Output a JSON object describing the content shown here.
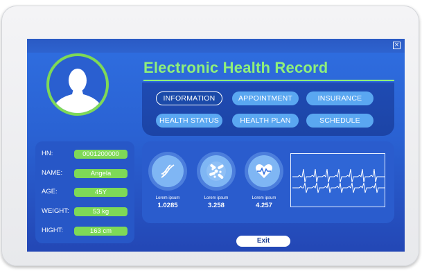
{
  "header": {
    "title": "Electronic Health Record",
    "close_icon": "close-icon"
  },
  "menu": {
    "buttons": [
      {
        "label": "INFORMATION",
        "active": true
      },
      {
        "label": "APPOINTMENT",
        "active": false
      },
      {
        "label": "INSURANCE",
        "active": false
      },
      {
        "label": "HEALTH STATUS",
        "active": false
      },
      {
        "label": "HEALTH PLAN",
        "active": false
      },
      {
        "label": "SCHEDULE",
        "active": false
      }
    ]
  },
  "patient": {
    "fields": [
      {
        "label": "HN:",
        "value": "0001200000"
      },
      {
        "label": "NAME:",
        "value": "Angela"
      },
      {
        "label": "AGE:",
        "value": "45Y"
      },
      {
        "label": "WEIGHT:",
        "value": "53 kg"
      },
      {
        "label": "HIGHT:",
        "value": "163 cm"
      }
    ]
  },
  "stats": [
    {
      "icon": "dna-icon",
      "label": "Lorem ipsum",
      "value": "1.0285"
    },
    {
      "icon": "pills-icon",
      "label": "Lorem ipsum",
      "value": "3.258"
    },
    {
      "icon": "heart-pulse-icon",
      "label": "Lorem ipsum",
      "value": "4.257"
    }
  ],
  "footer": {
    "exit_label": "Exit"
  },
  "colors": {
    "accent_green": "#7ed957",
    "title_green": "#8ff07a",
    "pill_blue": "#5aa7f1",
    "screen_blue": "#2f6ee0"
  }
}
